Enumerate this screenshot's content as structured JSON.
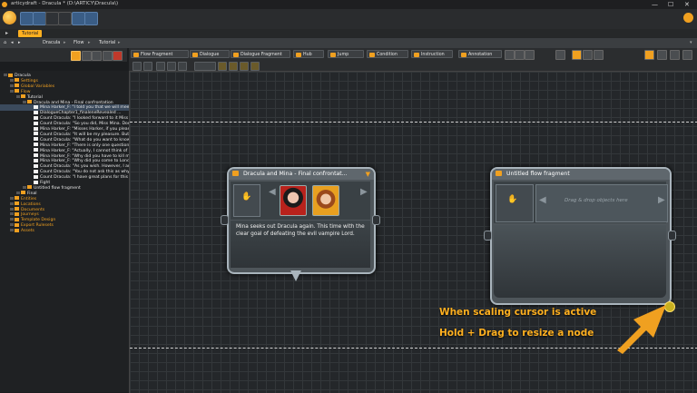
{
  "window": {
    "title": "articydraft - Dracula * (D:\\ARTICY\\Dracula\\)",
    "minimize": "—",
    "maximize": "☐",
    "close": "✕"
  },
  "tab": {
    "label": "Tutorial"
  },
  "breadcrumb": [
    "Dracula",
    "Flow",
    "Tutorial"
  ],
  "node_tabs": [
    "Flow Fragment",
    "Dialogue",
    "Dialogue Fragment",
    "Hub",
    "Jump",
    "Condition",
    "Instruction",
    "Annotation"
  ],
  "tree": [
    {
      "label": "Dracula",
      "depth": 0,
      "orange": false
    },
    {
      "label": "Settings",
      "depth": 1,
      "orange": true
    },
    {
      "label": "Global Variables",
      "depth": 1,
      "orange": true
    },
    {
      "label": "Flow",
      "depth": 1,
      "orange": true
    },
    {
      "label": "Tutorial",
      "depth": 2,
      "orange": false
    },
    {
      "label": "Dracula and Mina - Final confrontation",
      "depth": 3,
      "orange": false
    },
    {
      "label": "Mina Harker_F: \"I told you that we will meet a",
      "depth": 4,
      "orange": false
    },
    {
      "label": "DialogueChapter1_finaleneRevealed ...",
      "depth": 4,
      "orange": false
    },
    {
      "label": "Count Dracula: \"I looked forward to it Miss M",
      "depth": 4,
      "orange": false
    },
    {
      "label": "Count Dracula: \"So you did, Miss Mina. Don",
      "depth": 4,
      "orange": false
    },
    {
      "label": "Mina Harker_F: \"Misses Harker, if you please.",
      "depth": 4,
      "orange": false
    },
    {
      "label": "Count Dracula: \"It will be my pleasure. But I",
      "depth": 4,
      "orange": false
    },
    {
      "label": "Count Dracula: \"What do you want to know?",
      "depth": 4,
      "orange": false
    },
    {
      "label": "Mina Harker_F: \"There is only one question I",
      "depth": 4,
      "orange": false
    },
    {
      "label": "Mina Harker_F: \"Actually, I cannot think of an",
      "depth": 4,
      "orange": false
    },
    {
      "label": "Mina Harker_F: \"Why did you have to kill my",
      "depth": 4,
      "orange": false
    },
    {
      "label": "Mina Harker_F: \"Why did you come to Londo",
      "depth": 4,
      "orange": false
    },
    {
      "label": "Count Dracula: \"As you wish. However, I am",
      "depth": 4,
      "orange": false
    },
    {
      "label": "Count Dracula: \"You do not ask this as why",
      "depth": 4,
      "orange": false
    },
    {
      "label": "Count Dracula: \"I have great plans for this cit",
      "depth": 4,
      "orange": false
    },
    {
      "label": "Fight",
      "depth": 4,
      "orange": false
    },
    {
      "label": "Untitled flow fragment",
      "depth": 3,
      "orange": false
    },
    {
      "label": "Final",
      "depth": 2,
      "orange": false
    },
    {
      "label": "Entities",
      "depth": 1,
      "orange": true
    },
    {
      "label": "Locations",
      "depth": 1,
      "orange": true
    },
    {
      "label": "Documents",
      "depth": 1,
      "orange": true
    },
    {
      "label": "Journeys",
      "depth": 1,
      "orange": true
    },
    {
      "label": "Template Design",
      "depth": 1,
      "orange": true
    },
    {
      "label": "Export Rulesets",
      "depth": 1,
      "orange": true
    },
    {
      "label": "Assets",
      "depth": 1,
      "orange": true
    }
  ],
  "dialogue_node": {
    "title": "Dracula and Mina - Final confrontat...",
    "text": "Mina seeks out Dracula again. This time with the clear goal of defeating the evil vampire Lord."
  },
  "fragment_node": {
    "title": "Untitled flow fragment",
    "placeholder": "Drag & drop objects here"
  },
  "hint": {
    "line1": "When scaling cursor is active",
    "line2": "Hold + Drag to resize a node"
  },
  "colors": {
    "accent": "#ffb020",
    "canvas": "#24272a",
    "selection": "#3b4a5c"
  }
}
